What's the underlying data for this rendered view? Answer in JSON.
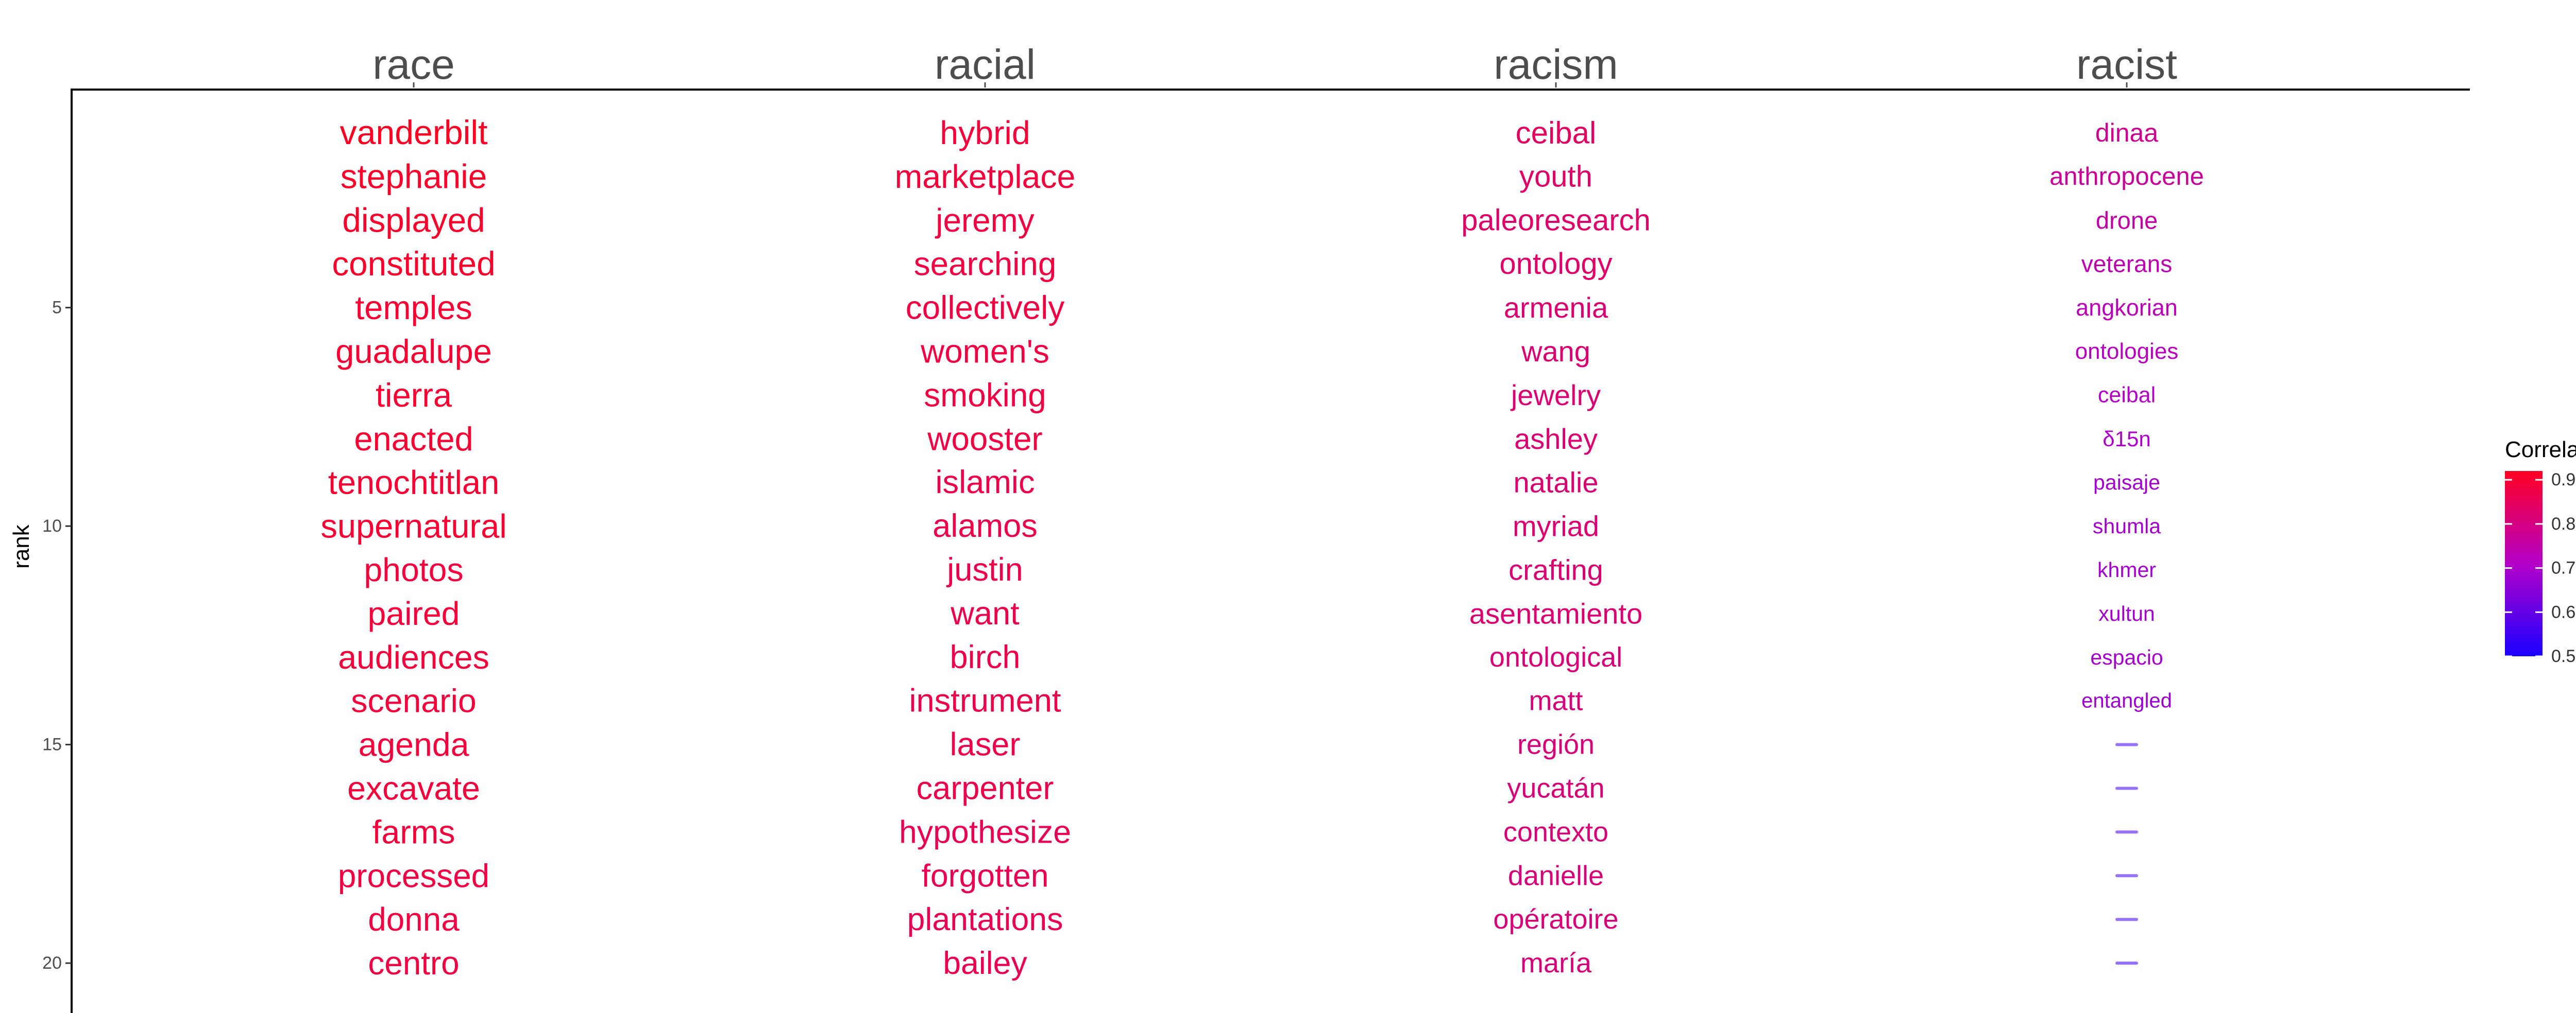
{
  "chart_data": {
    "type": "word-rank",
    "ylabel": "rank",
    "ylim": [
      1,
      20
    ],
    "yticks": [
      5,
      10,
      15,
      20
    ],
    "legend": {
      "title": "Correlation",
      "placement": "right",
      "ticks": [
        0.9,
        0.8,
        0.7,
        0.6,
        0.5
      ],
      "range": [
        0.5,
        0.92
      ],
      "low_color": "#1a00ff",
      "mid_color": "#b400c8",
      "high_color": "#ff0022"
    },
    "facets": [
      {
        "title": "race",
        "words": [
          "vanderbilt",
          "stephanie",
          "displayed",
          "constituted",
          "temples",
          "guadalupe",
          "tierra",
          "enacted",
          "tenochtitlan",
          "supernatural",
          "photos",
          "paired",
          "audiences",
          "scenario",
          "agenda",
          "excavate",
          "farms",
          "processed",
          "donna",
          "centro"
        ],
        "correlation": [
          0.92,
          0.91,
          0.91,
          0.91,
          0.9,
          0.9,
          0.9,
          0.9,
          0.9,
          0.9,
          0.89,
          0.89,
          0.89,
          0.89,
          0.89,
          0.89,
          0.89,
          0.88,
          0.88,
          0.88
        ]
      },
      {
        "title": "racial",
        "words": [
          "hybrid",
          "marketplace",
          "jeremy",
          "searching",
          "collectively",
          "women's",
          "smoking",
          "wooster",
          "islamic",
          "alamos",
          "justin",
          "want",
          "birch",
          "instrument",
          "laser",
          "carpenter",
          "hypothesize",
          "forgotten",
          "plantations",
          "bailey"
        ],
        "correlation": [
          0.89,
          0.89,
          0.88,
          0.88,
          0.88,
          0.88,
          0.88,
          0.88,
          0.87,
          0.87,
          0.87,
          0.87,
          0.87,
          0.87,
          0.87,
          0.87,
          0.86,
          0.86,
          0.86,
          0.86
        ]
      },
      {
        "title": "racism",
        "words": [
          "ceibal",
          "youth",
          "paleoresearch",
          "ontology",
          "armenia",
          "wang",
          "jewelry",
          "ashley",
          "natalie",
          "myriad",
          "crafting",
          "asentamiento",
          "ontological",
          "matt",
          "región",
          "yucatán",
          "contexto",
          "danielle",
          "opératoire",
          "maría"
        ],
        "correlation": [
          0.84,
          0.83,
          0.83,
          0.83,
          0.82,
          0.82,
          0.82,
          0.82,
          0.82,
          0.82,
          0.82,
          0.82,
          0.81,
          0.81,
          0.81,
          0.81,
          0.81,
          0.81,
          0.81,
          0.81
        ]
      },
      {
        "title": "racist",
        "words": [
          "dinaa",
          "anthropocene",
          "drone",
          "veterans",
          "angkorian",
          "ontologies",
          "ceibal",
          "δ15n",
          "paisaje",
          "shumla",
          "khmer",
          "xultun",
          "espacio",
          "entangled",
          "",
          "",
          "",
          "",
          "",
          ""
        ],
        "correlation": [
          0.78,
          0.77,
          0.75,
          0.74,
          0.73,
          0.72,
          0.71,
          0.7,
          0.69,
          0.69,
          0.69,
          0.69,
          0.69,
          0.68,
          0.56,
          0.56,
          0.56,
          0.55,
          0.55,
          0.54
        ]
      }
    ]
  }
}
